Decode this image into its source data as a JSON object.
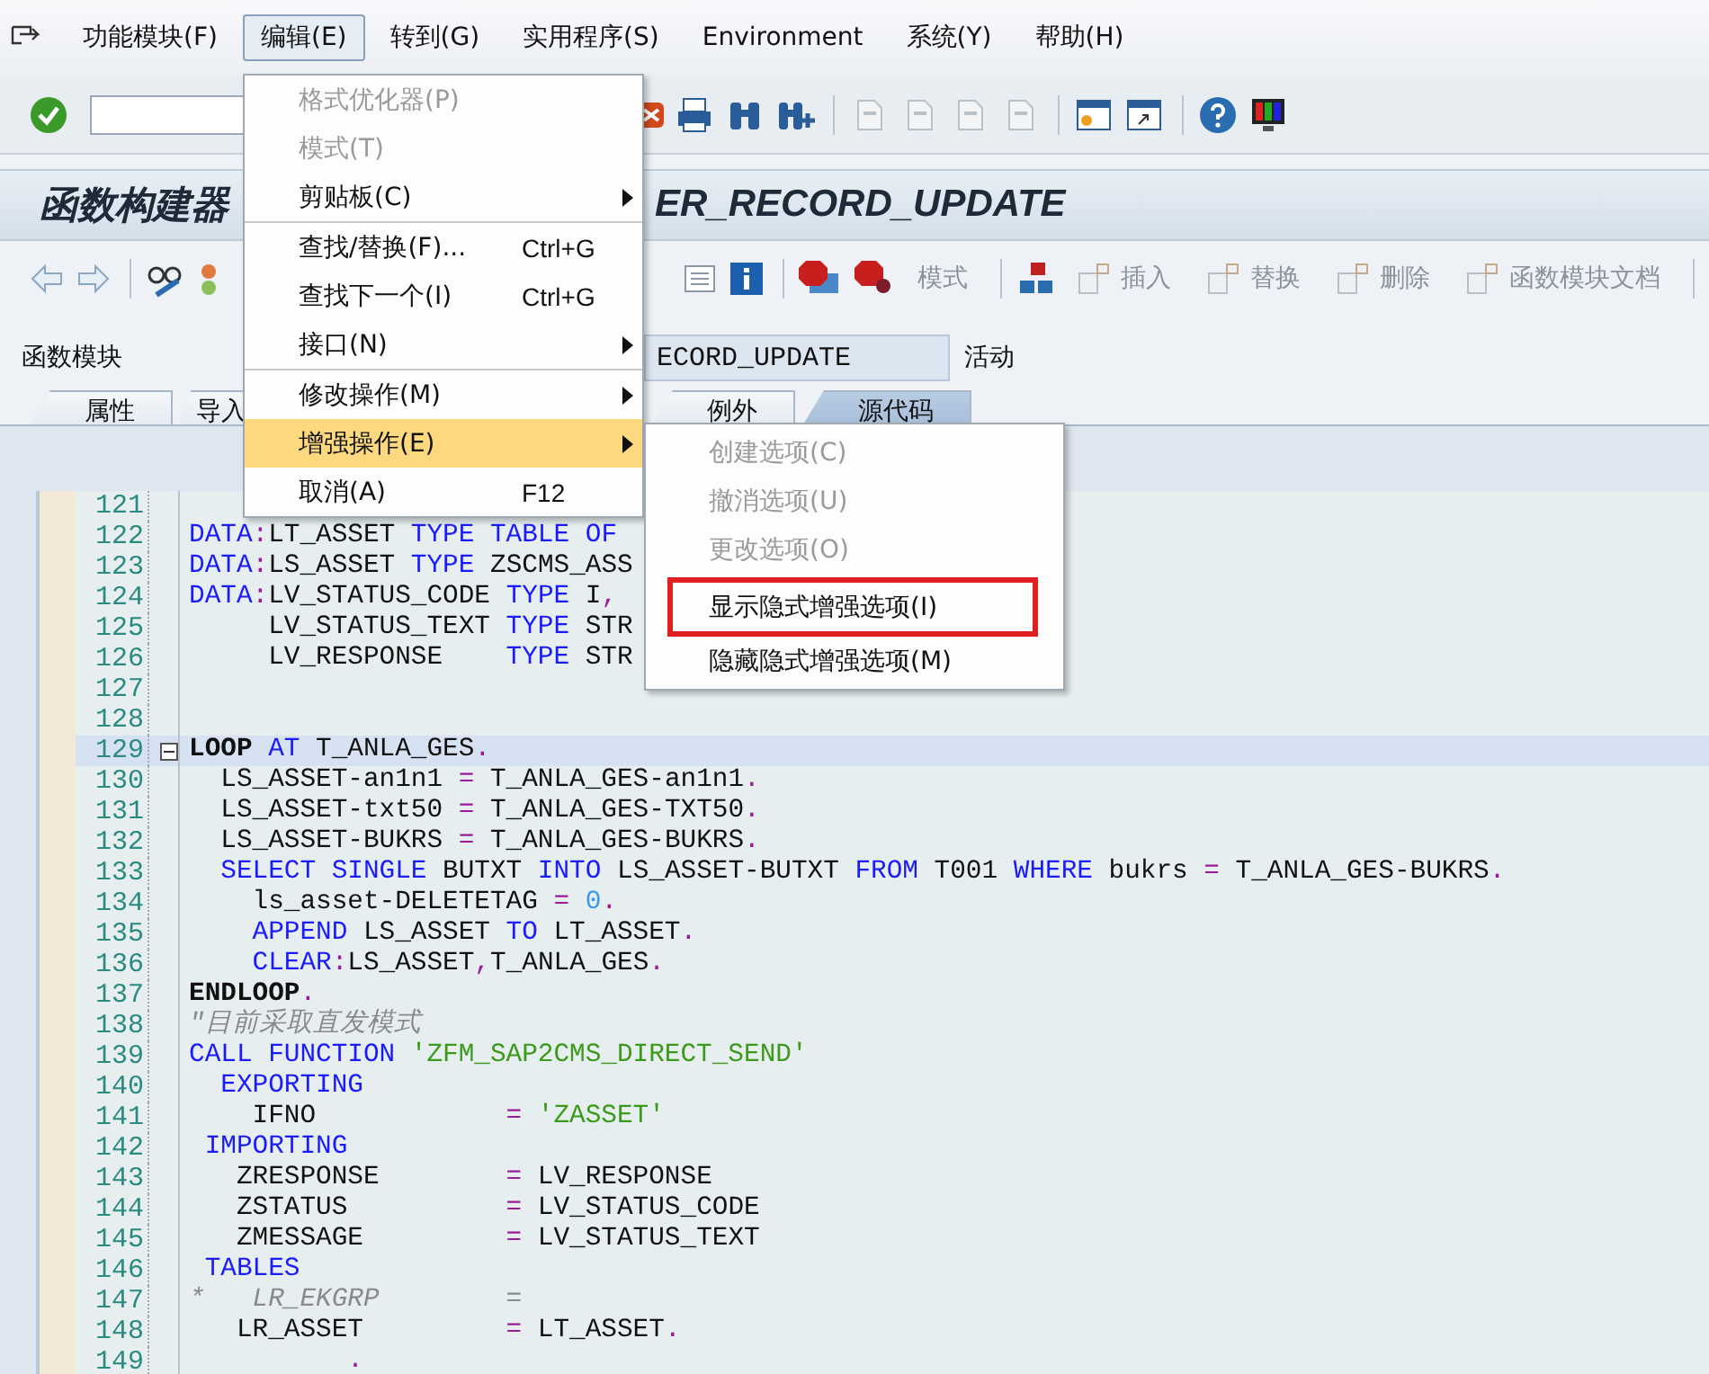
{
  "menubar": [
    {
      "label": "功能模块(F)",
      "selected": false
    },
    {
      "label": "编辑(E)",
      "selected": true
    },
    {
      "label": "转到(G)",
      "selected": false
    },
    {
      "label": "实用程序(S)",
      "selected": false
    },
    {
      "label": "Environment",
      "selected": false
    },
    {
      "label": "系统(Y)",
      "selected": false
    },
    {
      "label": "帮助(H)",
      "selected": false
    }
  ],
  "title": {
    "left": "函数构建器",
    "right": "ER_RECORD_UPDATE"
  },
  "app_toolbar": [
    {
      "label": "模式",
      "disabled": true
    },
    {
      "label": "插入",
      "disabled": true
    },
    {
      "label": "替换",
      "disabled": true
    },
    {
      "label": "删除",
      "disabled": true
    },
    {
      "label": "函数模块文档",
      "disabled": true
    }
  ],
  "function_module": {
    "label": "函数模块",
    "value": "ECORD_UPDATE",
    "status": "活动"
  },
  "tabs": [
    {
      "label": "属性",
      "selected": false
    },
    {
      "label": "导入",
      "selected": false
    },
    {
      "label": "例外",
      "selected": false
    },
    {
      "label": "源代码",
      "selected": true
    }
  ],
  "edit_menu": [
    {
      "label": "格式优化器(P)",
      "disabled": true,
      "submenu": false,
      "selected": false,
      "separator_before": false
    },
    {
      "label": "模式(T)",
      "disabled": true,
      "submenu": false,
      "selected": false,
      "separator_before": false
    },
    {
      "label": "剪贴板(C)",
      "disabled": false,
      "submenu": true,
      "selected": false,
      "separator_before": false
    },
    {
      "label": "查找/替换(F)...",
      "shortcut": "Ctrl+G",
      "disabled": false,
      "submenu": false,
      "selected": false,
      "separator_before": true
    },
    {
      "label": "查找下一个(I)",
      "shortcut": "Ctrl+G",
      "disabled": false,
      "submenu": false,
      "selected": false,
      "separator_before": false
    },
    {
      "label": "接口(N)",
      "disabled": false,
      "submenu": true,
      "selected": false,
      "separator_before": false
    },
    {
      "label": "修改操作(M)",
      "disabled": false,
      "submenu": true,
      "selected": false,
      "separator_before": true
    },
    {
      "label": "增强操作(E)",
      "disabled": false,
      "submenu": true,
      "selected": true,
      "separator_before": false
    },
    {
      "label": "取消(A)",
      "shortcut": "F12",
      "disabled": false,
      "submenu": false,
      "selected": false,
      "separator_before": false
    }
  ],
  "enhancement_submenu": [
    {
      "label": "创建选项(C)",
      "disabled": true,
      "marked": false,
      "separator_before": false
    },
    {
      "label": "撤消选项(U)",
      "disabled": true,
      "marked": false,
      "separator_before": false
    },
    {
      "label": "更改选项(O)",
      "disabled": true,
      "marked": false,
      "separator_before": false
    },
    {
      "label": "显示隐式增强选项(I)",
      "disabled": false,
      "marked": true,
      "separator_before": true
    },
    {
      "label": "隐藏隐式增强选项(M)",
      "disabled": false,
      "marked": false,
      "separator_before": false
    }
  ],
  "code_lines": [
    {
      "number": "121",
      "current": false
    },
    {
      "number": "122",
      "current": false,
      "tokens": [
        {
          "text": "DATA",
          "kind": "kw"
        },
        {
          "text": ":",
          "kind": "op"
        },
        {
          "text": "LT_ASSET ",
          "kind": "id"
        },
        {
          "text": "TYPE TABLE OF",
          "kind": "kw"
        }
      ]
    },
    {
      "number": "123",
      "current": false,
      "tokens": [
        {
          "text": "DATA",
          "kind": "kw"
        },
        {
          "text": ":",
          "kind": "op"
        },
        {
          "text": "LS_ASSET ",
          "kind": "id"
        },
        {
          "text": "TYPE",
          "kind": "kw"
        },
        {
          "text": " ZSCMS_ASS",
          "kind": "id"
        }
      ]
    },
    {
      "number": "124",
      "current": false,
      "tokens": [
        {
          "text": "DATA",
          "kind": "kw"
        },
        {
          "text": ":",
          "kind": "op"
        },
        {
          "text": "LV_STATUS_CODE ",
          "kind": "id"
        },
        {
          "text": "TYPE",
          "kind": "kw"
        },
        {
          "text": " I",
          "kind": "id"
        },
        {
          "text": ",",
          "kind": "op"
        }
      ]
    },
    {
      "number": "125",
      "current": false,
      "tokens": [
        {
          "text": "     LV_STATUS_TEXT ",
          "kind": "id"
        },
        {
          "text": "TYPE",
          "kind": "kw"
        },
        {
          "text": " STR",
          "kind": "id"
        }
      ]
    },
    {
      "number": "126",
      "current": false,
      "tokens": [
        {
          "text": "     LV_RESPONSE    ",
          "kind": "id"
        },
        {
          "text": "TYPE",
          "kind": "kw"
        },
        {
          "text": " STR",
          "kind": "id"
        }
      ]
    },
    {
      "number": "127",
      "current": false
    },
    {
      "number": "128",
      "current": false
    },
    {
      "number": "129",
      "current": true,
      "tokens": [
        {
          "text": "LOOP",
          "kind": "bold"
        },
        {
          "text": " AT",
          "kind": "kw"
        },
        {
          "text": " T_ANLA_GES",
          "kind": "id"
        },
        {
          "text": ".",
          "kind": "op"
        }
      ]
    },
    {
      "number": "130",
      "current": false,
      "tokens": [
        {
          "text": "  LS_ASSET-an1n1 ",
          "kind": "id"
        },
        {
          "text": "=",
          "kind": "op"
        },
        {
          "text": " T_ANLA_GES-an1n1",
          "kind": "id"
        },
        {
          "text": ".",
          "kind": "op"
        }
      ]
    },
    {
      "number": "131",
      "current": false,
      "tokens": [
        {
          "text": "  LS_ASSET-txt50 ",
          "kind": "id"
        },
        {
          "text": "=",
          "kind": "op"
        },
        {
          "text": " T_ANLA_GES-TXT50",
          "kind": "id"
        },
        {
          "text": ".",
          "kind": "op"
        }
      ]
    },
    {
      "number": "132",
      "current": false,
      "tokens": [
        {
          "text": "  LS_ASSET-BUKRS ",
          "kind": "id"
        },
        {
          "text": "=",
          "kind": "op"
        },
        {
          "text": " T_ANLA_GES-BUKRS",
          "kind": "id"
        },
        {
          "text": ".",
          "kind": "op"
        }
      ]
    },
    {
      "number": "133",
      "current": false,
      "tokens": [
        {
          "text": "  SELECT SINGLE",
          "kind": "kw"
        },
        {
          "text": " BUTXT ",
          "kind": "id"
        },
        {
          "text": "INTO",
          "kind": "kw"
        },
        {
          "text": " LS_ASSET-BUTXT ",
          "kind": "id"
        },
        {
          "text": "FROM",
          "kind": "kw"
        },
        {
          "text": " T001 ",
          "kind": "id"
        },
        {
          "text": "WHERE",
          "kind": "kw"
        },
        {
          "text": " bukrs ",
          "kind": "id"
        },
        {
          "text": "=",
          "kind": "op"
        },
        {
          "text": " T_ANLA_GES-BUKRS",
          "kind": "id"
        },
        {
          "text": ".",
          "kind": "op"
        }
      ]
    },
    {
      "number": "134",
      "current": false,
      "tokens": [
        {
          "text": "    ls_asset-DELETETAG ",
          "kind": "id"
        },
        {
          "text": "=",
          "kind": "op"
        },
        {
          "text": " 0",
          "kind": "num"
        },
        {
          "text": ".",
          "kind": "op"
        }
      ]
    },
    {
      "number": "135",
      "current": false,
      "tokens": [
        {
          "text": "    APPEND",
          "kind": "kw"
        },
        {
          "text": " LS_ASSET ",
          "kind": "id"
        },
        {
          "text": "TO",
          "kind": "kw"
        },
        {
          "text": " LT_ASSET",
          "kind": "id"
        },
        {
          "text": ".",
          "kind": "op"
        }
      ]
    },
    {
      "number": "136",
      "current": false,
      "tokens": [
        {
          "text": "    CLEAR",
          "kind": "kw"
        },
        {
          "text": ":",
          "kind": "op"
        },
        {
          "text": "LS_ASSET",
          "kind": "id"
        },
        {
          "text": ",",
          "kind": "op"
        },
        {
          "text": "T_ANLA_GES",
          "kind": "id"
        },
        {
          "text": ".",
          "kind": "op"
        }
      ]
    },
    {
      "number": "137",
      "current": false,
      "tokens": [
        {
          "text": "ENDLOOP",
          "kind": "bold"
        },
        {
          "text": ".",
          "kind": "op"
        }
      ]
    },
    {
      "number": "138",
      "current": false,
      "tokens": [
        {
          "text": "\"目前采取直发模式",
          "kind": "cmt"
        }
      ]
    },
    {
      "number": "139",
      "current": false,
      "tokens": [
        {
          "text": "CALL FUNCTION",
          "kind": "kw"
        },
        {
          "text": " 'ZFM_SAP2CMS_DIRECT_SEND'",
          "kind": "str"
        }
      ]
    },
    {
      "number": "140",
      "current": false,
      "tokens": [
        {
          "text": "  EXPORTING",
          "kind": "kw"
        }
      ]
    },
    {
      "number": "141",
      "current": false,
      "tokens": [
        {
          "text": "    IFNO            ",
          "kind": "id"
        },
        {
          "text": "=",
          "kind": "op"
        },
        {
          "text": " 'ZASSET'",
          "kind": "str"
        }
      ]
    },
    {
      "number": "142",
      "current": false,
      "tokens": [
        {
          "text": " IMPORTING",
          "kind": "kw"
        }
      ]
    },
    {
      "number": "143",
      "current": false,
      "tokens": [
        {
          "text": "   ZRESPONSE        ",
          "kind": "id"
        },
        {
          "text": "=",
          "kind": "op"
        },
        {
          "text": " LV_RESPONSE",
          "kind": "id"
        }
      ]
    },
    {
      "number": "144",
      "current": false,
      "tokens": [
        {
          "text": "   ZSTATUS          ",
          "kind": "id"
        },
        {
          "text": "=",
          "kind": "op"
        },
        {
          "text": " LV_STATUS_CODE",
          "kind": "id"
        }
      ]
    },
    {
      "number": "145",
      "current": false,
      "tokens": [
        {
          "text": "   ZMESSAGE         ",
          "kind": "id"
        },
        {
          "text": "=",
          "kind": "op"
        },
        {
          "text": " LV_STATUS_TEXT",
          "kind": "id"
        }
      ]
    },
    {
      "number": "146",
      "current": false,
      "tokens": [
        {
          "text": " TABLES",
          "kind": "kw"
        }
      ]
    },
    {
      "number": "147",
      "current": false,
      "tokens": [
        {
          "text": "*   LR_EKGRP        =",
          "kind": "cmt"
        }
      ]
    },
    {
      "number": "148",
      "current": false,
      "tokens": [
        {
          "text": "   LR_ASSET         ",
          "kind": "id"
        },
        {
          "text": "=",
          "kind": "op"
        },
        {
          "text": " LT_ASSET",
          "kind": "id"
        },
        {
          "text": ".",
          "kind": "op"
        }
      ]
    },
    {
      "number": "149",
      "current": false,
      "tokens": [
        {
          "text": "          .",
          "kind": "op"
        }
      ]
    }
  ]
}
